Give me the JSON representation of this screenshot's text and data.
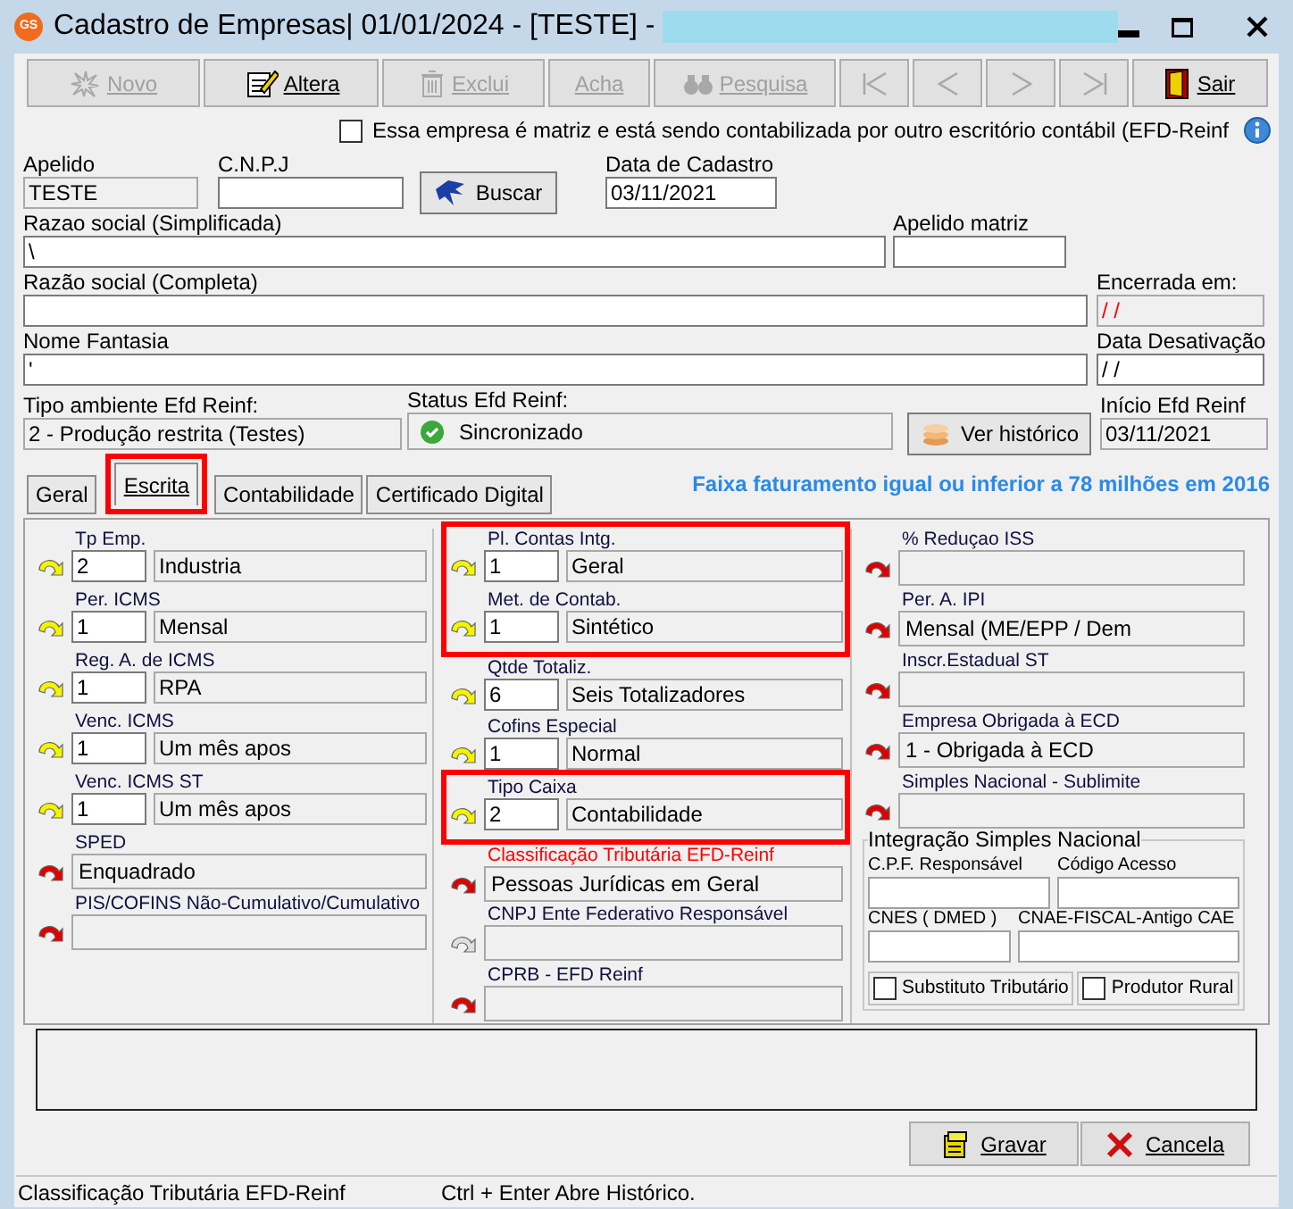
{
  "window": {
    "logo": "GS",
    "title": "Cadastro de Empresas|  01/01/2024 - [TESTE] -"
  },
  "toolbar": [
    {
      "label": "Novo",
      "disabled": true
    },
    {
      "label": "Altera",
      "disabled": false
    },
    {
      "label": "Exclui",
      "disabled": true
    },
    {
      "label": "Acha",
      "disabled": true
    },
    {
      "label": "Pesquisa",
      "disabled": true
    }
  ],
  "nav_buttons": [
    {
      "kind": "first",
      "disabled": true
    },
    {
      "kind": "prev",
      "disabled": true
    },
    {
      "kind": "next",
      "disabled": true
    },
    {
      "kind": "last",
      "disabled": true
    }
  ],
  "exit_button": {
    "label": "Sair"
  },
  "matrix_checkbox": {
    "label": "Essa empresa é matriz e está sendo contabilizada por outro escritório contábil (EFD-Reinf",
    "checked": false
  },
  "header": [
    [
      {
        "kind": "field",
        "label": "Apelido",
        "value": "TESTE",
        "editable": false
      },
      {
        "kind": "field",
        "label": "C.N.P.J",
        "editable": true
      },
      {
        "kind": "button",
        "label": "Buscar"
      },
      {
        "kind": "field",
        "label": "Data de Cadastro",
        "value": "03/11/2021",
        "editable": true
      }
    ],
    [
      {
        "kind": "field",
        "label": "Razao social (Simplificada)",
        "value": "\\",
        "editable": true
      },
      {
        "kind": "field",
        "label": "Apelido matriz",
        "editable": true
      }
    ],
    [
      {
        "kind": "field",
        "label": "Razão social (Completa)",
        "editable": true
      },
      {
        "kind": "field",
        "label": "Encerrada em:",
        "value": "/ /",
        "editable": false,
        "alert": true
      }
    ],
    [
      {
        "kind": "field",
        "label": "Nome Fantasia",
        "value": "'",
        "editable": true
      },
      {
        "kind": "field",
        "label": "Data Desativação",
        "value": "/ /",
        "editable": true
      }
    ],
    [
      {
        "kind": "field",
        "label": "Tipo ambiente Efd Reinf:",
        "value": "2 - Produção restrita (Testes)",
        "editable": false
      },
      {
        "kind": "status",
        "label": "Status Efd Reinf:",
        "value": "Sincronizado",
        "synced": true
      },
      {
        "kind": "button",
        "label": "Ver histórico"
      },
      {
        "kind": "field",
        "label": "Início Efd Reinf",
        "value": "03/11/2021",
        "editable": false
      }
    ]
  ],
  "tabs": [
    {
      "label": "Geral",
      "selected": false
    },
    {
      "label": "Escrita",
      "selected": true,
      "highlighted": true
    },
    {
      "label": "Contabilidade",
      "selected": false
    },
    {
      "label": "Certificado Digital",
      "selected": false
    }
  ],
  "banner": "Faixa faturamento igual ou inferior a 78 milhões em 2016",
  "columns": [
    {
      "items": [
        {
          "kind": "lookup",
          "label": "Tp Emp.",
          "code": "2",
          "description": "Industria",
          "color": "#f4f400"
        },
        {
          "kind": "lookup",
          "label": "Per. ICMS",
          "code": "1",
          "description": "Mensal",
          "color": "#f4f400"
        },
        {
          "kind": "lookup",
          "label": "Reg.  A. de ICMS",
          "code": "1",
          "description": "RPA",
          "color": "#f4f400"
        },
        {
          "kind": "lookup",
          "label": "Venc. ICMS",
          "code": "1",
          "description": "Um mês apos",
          "color": "#f4f400"
        },
        {
          "kind": "lookup",
          "label": "Venc. ICMS ST",
          "code": "1",
          "description": "Um mês apos",
          "color": "#f4f400"
        },
        {
          "kind": "text",
          "label": "SPED",
          "value": "Enquadrado",
          "color": "#e00000"
        },
        {
          "kind": "text",
          "label": "PIS/COFINS Não-Cumulativo/Cumulativo",
          "color": "#e00000"
        }
      ]
    },
    {
      "items": [
        {
          "kind": "lookup",
          "label": "Pl.  Contas Intg.",
          "code": "1",
          "description": "Geral",
          "color": "#f4f400",
          "highlighted": true
        },
        {
          "kind": "lookup",
          "label": "Met. de Contab.",
          "code": "1",
          "description": "Sintético",
          "color": "#f4f400",
          "highlighted": true
        },
        {
          "kind": "lookup",
          "label": "Qtde Totaliz.",
          "code": "6",
          "description": "Seis Totalizadores",
          "color": "#f4f400"
        },
        {
          "kind": "lookup",
          "label": "Cofins Especial",
          "code": "1",
          "description": "Normal",
          "color": "#f4f400"
        },
        {
          "kind": "lookup",
          "label": "Tipo Caixa",
          "code": "2",
          "description": "Contabilidade",
          "color": "#f4f400",
          "highlighted": true
        },
        {
          "kind": "text",
          "label": "Classificação Tributária EFD-Reinf",
          "label_alert": true,
          "value": "Pessoas Jurídicas em Geral",
          "color": "#e00000"
        },
        {
          "kind": "text",
          "label": "CNPJ Ente Federativo Responsável",
          "color": "#e0e0e0"
        },
        {
          "kind": "text",
          "label": "CPRB - EFD Reinf",
          "color": "#e00000"
        }
      ]
    },
    {
      "items": [
        {
          "kind": "text",
          "label": "% Reduçao ISS",
          "color": "#e00000"
        },
        {
          "kind": "text",
          "label": "Per. A.  IPI",
          "value": "Mensal (ME/EPP / Dem",
          "color": "#e00000"
        },
        {
          "kind": "text",
          "label": "Inscr.Estadual ST",
          "color": "#e00000"
        },
        {
          "kind": "text",
          "label": "Empresa Obrigada à ECD",
          "value": "1 - Obrigada à ECD",
          "color": "#e00000"
        },
        {
          "kind": "text",
          "label": "Simples Nacional - Sublimite",
          "color": "#e00000"
        }
      ],
      "group": {
        "title": "Integração Simples Nacional",
        "fields": [
          {
            "label": "C.P.F. Responsável"
          },
          {
            "label": "Código Acesso"
          },
          {
            "label": "CNES ( DMED )"
          },
          {
            "label": "CNAE-FISCAL-Antigo CAE"
          }
        ],
        "checkboxes": [
          {
            "label": "Substituto Tributário",
            "checked": false
          },
          {
            "label": "Produtor Rural",
            "checked": false
          }
        ]
      }
    }
  ],
  "footer_buttons": [
    {
      "label": "Gravar"
    },
    {
      "label": "Cancela"
    }
  ],
  "status_bar": [
    "Classificação Tributária EFD-Reinf",
    "Ctrl + Enter Abre Histórico."
  ]
}
